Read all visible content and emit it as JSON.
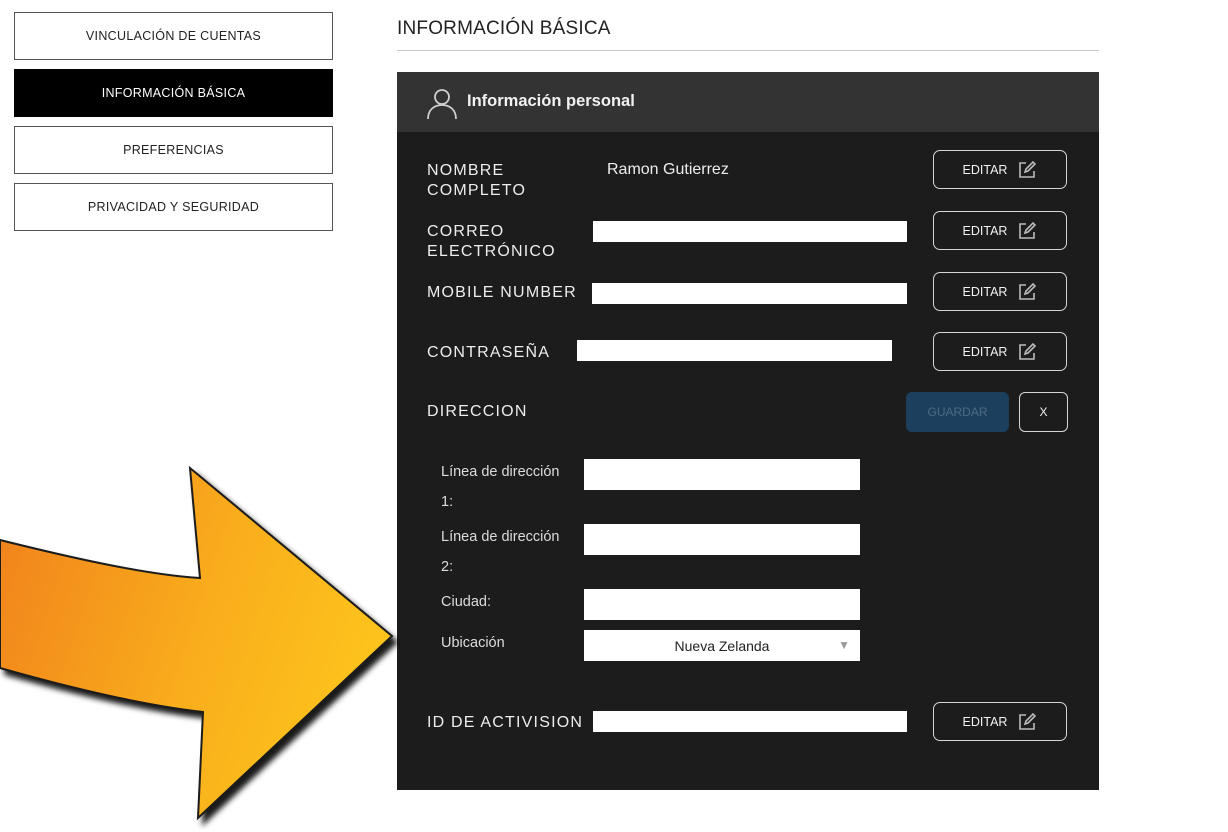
{
  "sidebar": {
    "items": [
      {
        "label": "VINCULACIÓN DE CUENTAS",
        "active": false
      },
      {
        "label": "INFORMACIÓN BÁSICA",
        "active": true
      },
      {
        "label": "PREFERENCIAS",
        "active": false
      },
      {
        "label": "PRIVACIDAD Y SEGURIDAD",
        "active": false
      }
    ]
  },
  "page": {
    "title": "INFORMACIÓN BÁSICA"
  },
  "panel": {
    "title": "Información personal",
    "header_icon": "user-icon",
    "fields": {
      "full_name": {
        "label": "NOMBRE COMPLETO",
        "value": "Ramon Gutierrez",
        "edit_label": "EDITAR"
      },
      "email": {
        "label": "CORREO ELECTRÓNICO",
        "value": "",
        "edit_label": "EDITAR"
      },
      "mobile": {
        "label": "MOBILE NUMBER",
        "value": "",
        "edit_label": "EDITAR"
      },
      "password": {
        "label": "CONTRASEÑA",
        "value": "",
        "edit_label": "EDITAR"
      },
      "activision_id": {
        "label": "ID DE ACTIVISION",
        "value": "",
        "edit_label": "EDITAR"
      }
    },
    "address": {
      "label": "DIRECCION",
      "save_label": "GUARDAR",
      "close_label": "X",
      "line1_label": "Línea de dirección 1:",
      "line1_value": "",
      "line2_label": "Línea de dirección 2:",
      "line2_value": "",
      "city_label": "Ciudad:",
      "city_value": "",
      "location_label": "Ubicación",
      "location_value": "Nueva Zelanda"
    }
  },
  "colors": {
    "panel_bg": "#1c1c1c",
    "panel_header_bg": "#333333",
    "save_button_bg": "#1d3f5e",
    "arrow_orange": "#f6a21a"
  }
}
